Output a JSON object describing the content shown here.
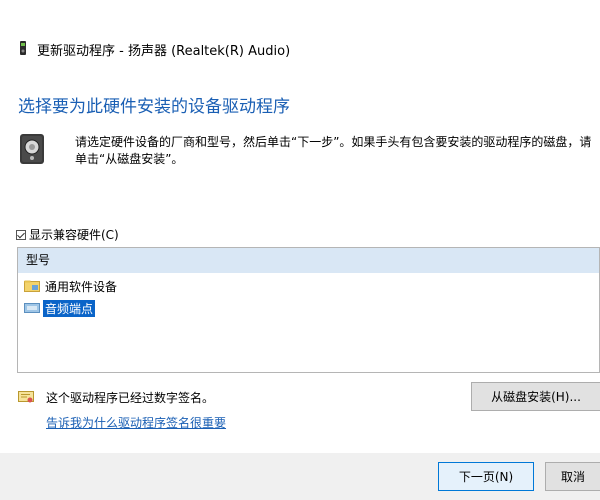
{
  "window": {
    "title": "更新驱动程序 - 扬声器 (Realtek(R) Audio)",
    "title_icon": "device-icon"
  },
  "page": {
    "heading": "选择要为此硬件安装的设备驱动程序",
    "description": "请选定硬件设备的厂商和型号，然后单击“下一步”。如果手头有包含要安装的驱动程序的磁盘，请单击“从磁盘安装”。",
    "description_icon": "speaker-icon"
  },
  "compat": {
    "checked": true,
    "label": "显示兼容硬件(C)"
  },
  "list": {
    "header": "型号",
    "items": [
      {
        "label": "通用软件设备",
        "icon": "folder-device-icon",
        "selected": false
      },
      {
        "label": "音频端点",
        "icon": "audio-device-icon",
        "selected": true
      }
    ]
  },
  "signature": {
    "text": "这个驱动程序已经过数字签名。",
    "icon": "certificate-icon",
    "link": "告诉我为什么驱动程序签名很重要"
  },
  "buttons": {
    "have_disk": "从磁盘安装(H)...",
    "next": "下一页(N)",
    "cancel": "取消"
  },
  "colors": {
    "heading": "#1a5fb4",
    "selection": "#0a64c8",
    "list_header": "#d9e7f5",
    "footer": "#f0f0f0"
  }
}
